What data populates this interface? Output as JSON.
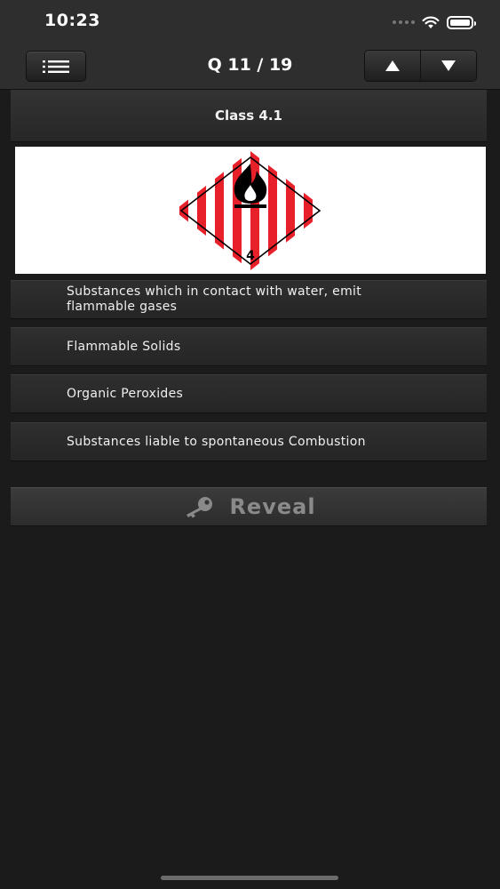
{
  "status_bar": {
    "time": "10:23"
  },
  "nav": {
    "title": "Q 11 / 19",
    "menu_icon": "list-icon",
    "prev_icon": "triangle-up-icon",
    "next_icon": "triangle-down-icon"
  },
  "question": {
    "header": "Class 4.1",
    "placard": {
      "number": "4",
      "icon": "flame-icon",
      "stripe_color": "#e8202a"
    }
  },
  "answers": [
    {
      "text": "Substances which in contact with water, emit flammable gases"
    },
    {
      "text": "Flammable Solids"
    },
    {
      "text": "Organic Peroxides"
    },
    {
      "text": "Substances liable to spontaneous Combustion"
    }
  ],
  "reveal": {
    "label": "Reveal",
    "icon": "key-icon"
  }
}
